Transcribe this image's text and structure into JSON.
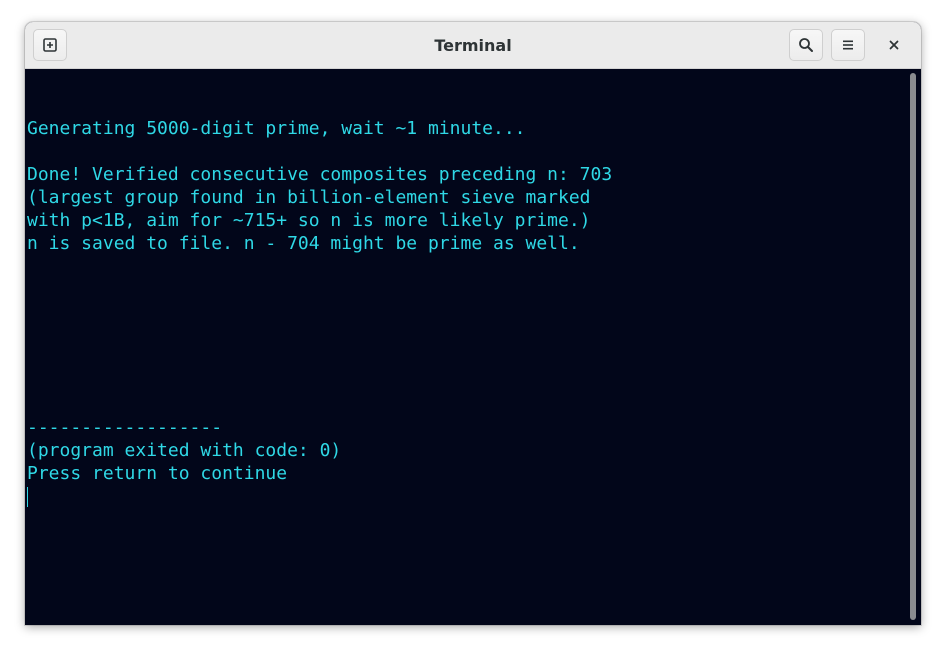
{
  "window": {
    "title": "Terminal"
  },
  "icons": {
    "new_tab": "new-tab-icon",
    "search": "search-icon",
    "menu": "hamburger-menu-icon",
    "close": "close-icon"
  },
  "colors": {
    "terminal_bg": "#02061a",
    "terminal_fg": "#2fd8e6",
    "titlebar_bg": "#ebebeb"
  },
  "terminal": {
    "lines": [
      "",
      "Generating 5000-digit prime, wait ~1 minute...",
      "",
      "Done! Verified consecutive composites preceding n: 703",
      "(largest group found in billion-element sieve marked",
      "with p<1B, aim for ~715+ so n is more likely prime.)",
      "n is saved to file. n - 704 might be prime as well.",
      "",
      "",
      "",
      "",
      "",
      "",
      "",
      "------------------",
      "(program exited with code: 0)",
      "Press return to continue"
    ]
  }
}
